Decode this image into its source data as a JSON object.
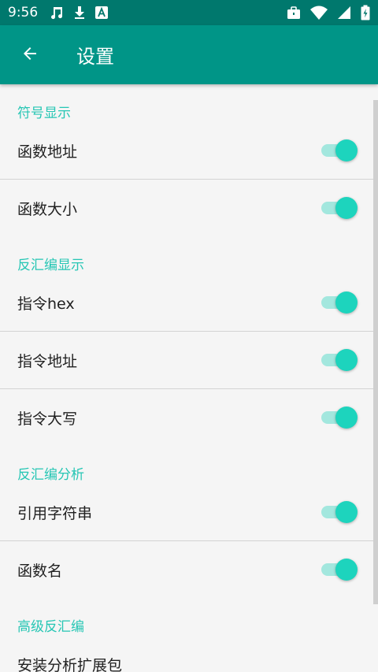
{
  "status_bar": {
    "time": "9:56",
    "left_icons": [
      "music-icon",
      "download-icon",
      "a-icon"
    ],
    "right_icons": [
      "work-icon",
      "wifi-icon",
      "signal-icon",
      "battery-icon"
    ]
  },
  "app_bar": {
    "title": "设置",
    "back_icon": "arrow-back-icon"
  },
  "colors": {
    "app_bar": "#009587",
    "status_bar": "#00786d",
    "accent": "#1dd4bd",
    "section_header": "#26c6b4"
  },
  "sections": [
    {
      "header": "符号显示",
      "items": [
        {
          "label": "函数地址",
          "enabled": true
        },
        {
          "label": "函数大小",
          "enabled": true
        }
      ]
    },
    {
      "header": "反汇编显示",
      "items": [
        {
          "label": "指令hex",
          "enabled": true
        },
        {
          "label": "指令地址",
          "enabled": true
        },
        {
          "label": "指令大写",
          "enabled": true
        }
      ]
    },
    {
      "header": "反汇编分析",
      "items": [
        {
          "label": "引用字符串",
          "enabled": true
        },
        {
          "label": "函数名",
          "enabled": true
        }
      ]
    },
    {
      "header": "高级反汇编",
      "items": [
        {
          "label": "安装分析扩展包"
        }
      ]
    }
  ]
}
